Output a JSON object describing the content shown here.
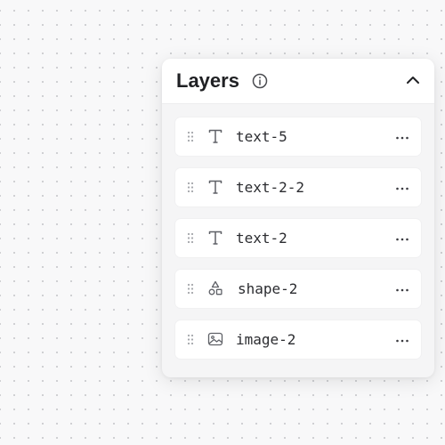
{
  "panel": {
    "title": "Layers",
    "info_icon": "info-circle-icon",
    "collapse_icon": "chevron-up-icon"
  },
  "layers": [
    {
      "name": "text-5",
      "type": "text",
      "icon": "text-type-icon"
    },
    {
      "name": "text-2-2",
      "type": "text",
      "icon": "text-type-icon"
    },
    {
      "name": "text-2",
      "type": "text",
      "icon": "text-type-icon"
    },
    {
      "name": "shape-2",
      "type": "shape",
      "icon": "shapes-icon"
    },
    {
      "name": "image-2",
      "type": "image",
      "icon": "image-icon"
    }
  ],
  "row_actions_icon": "more-horizontal-icon",
  "drag_icon": "drag-handle-icon",
  "colors": {
    "canvas_background": "#f8f8f9",
    "panel_background": "#f5f5f6",
    "row_background": "#ffffff",
    "text": "#202124",
    "icon": "#6b6d73"
  }
}
